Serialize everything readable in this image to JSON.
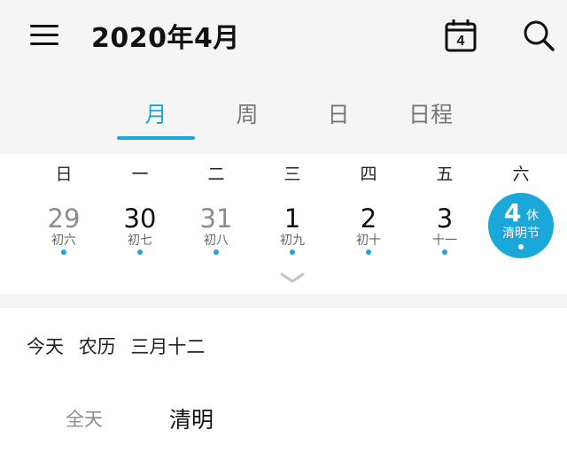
{
  "header": {
    "title": "2020年4月",
    "today_day": "4"
  },
  "tabs": [
    {
      "label": "月",
      "active": true
    },
    {
      "label": "周",
      "active": false
    },
    {
      "label": "日",
      "active": false
    },
    {
      "label": "日程",
      "active": false
    }
  ],
  "weekdays": [
    "日",
    "一",
    "二",
    "三",
    "四",
    "五",
    "六"
  ],
  "days": [
    {
      "num": "29",
      "lunar": "初六",
      "muted": true,
      "dot": true
    },
    {
      "num": "30",
      "lunar": "初七",
      "muted": false,
      "dot": true
    },
    {
      "num": "31",
      "lunar": "初八",
      "muted": true,
      "dot": true
    },
    {
      "num": "1",
      "lunar": "初九",
      "muted": false,
      "dot": true
    },
    {
      "num": "2",
      "lunar": "初十",
      "muted": false,
      "dot": true
    },
    {
      "num": "3",
      "lunar": "十一",
      "muted": false,
      "dot": true
    },
    {
      "num": "4",
      "lunar": "清明节",
      "badge": "休",
      "selected": true,
      "dot": true
    }
  ],
  "today_info": {
    "label": "今天",
    "lunar_prefix": "农历",
    "lunar_date": "三月十二"
  },
  "event": {
    "time": "全天",
    "title": "清明"
  },
  "colors": {
    "accent": "#1aa7d9",
    "background": "#f5f5f5",
    "panel": "#ffffff"
  }
}
